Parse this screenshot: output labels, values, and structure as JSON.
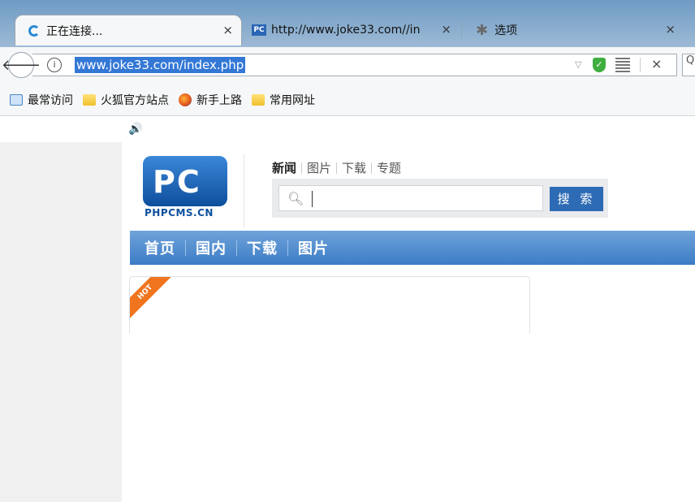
{
  "tabs": [
    {
      "label": "正在连接...",
      "close": "×"
    },
    {
      "favicon": "PC",
      "label": "http://www.joke33.com//in",
      "close": "×"
    },
    {
      "label": "选项",
      "close": "×"
    }
  ],
  "address": {
    "url": "www.joke33.com/index.php",
    "info": "i",
    "stop": "×",
    "dropdown": "▽",
    "search_edge": "Q"
  },
  "bookmarks": [
    "最常访问",
    "火狐官方站点",
    "新手上路",
    "常用网址"
  ],
  "site": {
    "logo_letters": "PC",
    "logo_text": "PHPCMS.CN",
    "search_tabs": [
      "新闻",
      "图片",
      "下载",
      "专题"
    ],
    "search_button": "搜 索",
    "nav": [
      "首页",
      "国内",
      "下载",
      "图片"
    ],
    "hot_badge": "HOT"
  },
  "icons": {
    "back": "back-arrow-icon",
    "speaker": "speaker-icon",
    "shield": "shield-icon",
    "qr": "qr-code-icon",
    "gear": "gear-icon"
  }
}
